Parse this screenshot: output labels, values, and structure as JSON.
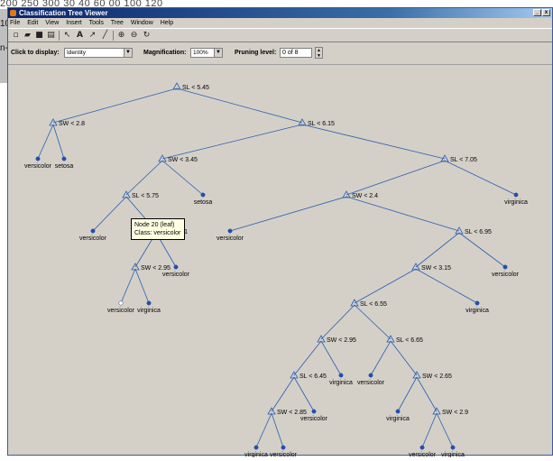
{
  "background": {
    "ruler_text": "200    250    300  30    40    60    00    100   120",
    "left_labels": [
      "10",
      "n-"
    ]
  },
  "window": {
    "title": "Classification Tree Viewer",
    "buttons": {
      "minimize": "_",
      "maximize": "□",
      "close": "x"
    }
  },
  "menu": [
    "File",
    "Edit",
    "View",
    "Insert",
    "Tools",
    "Tree",
    "Window",
    "Help"
  ],
  "toolbar": {
    "icons": [
      "new-file-icon",
      "open-folder-icon",
      "save-icon",
      "print-icon",
      "pointer-icon",
      "text-icon",
      "arrow-icon",
      "line-icon",
      "zoom-in-icon",
      "zoom-out-icon",
      "rotate-icon"
    ],
    "glyphs": [
      "▫",
      "▰",
      "■",
      "▤",
      "↖",
      "A",
      "↗",
      "╱",
      "⊕",
      "⊖",
      "↻"
    ]
  },
  "controls": {
    "click_label": "Click to display:",
    "click_value": "Identity",
    "magnification_label": "Magnification:",
    "magnification_value": "100%",
    "pruning_label": "Pruning level:",
    "pruning_value": "0 of 8"
  },
  "tree": {
    "nodes": [
      {
        "id": 1,
        "label": "SL < 5.45",
        "type": "branch"
      },
      {
        "id": 2,
        "label": "SW < 2.8",
        "type": "branch"
      },
      {
        "id": 3,
        "label": "SL < 6.15",
        "type": "branch"
      },
      {
        "id": 4,
        "label": "versicolor",
        "type": "leaf"
      },
      {
        "id": 5,
        "label": "setosa",
        "type": "leaf"
      },
      {
        "id": 6,
        "label": "SW < 3.45",
        "type": "branch"
      },
      {
        "id": 7,
        "label": "SL < 7.05",
        "type": "branch"
      },
      {
        "id": 8,
        "label": "SL < 5.75",
        "type": "branch"
      },
      {
        "id": 9,
        "label": "setosa",
        "type": "leaf"
      },
      {
        "id": 10,
        "label": "SW < 2.4",
        "type": "branch"
      },
      {
        "id": 11,
        "label": "virginica",
        "type": "leaf"
      },
      {
        "id": 12,
        "label": "versicolor",
        "type": "leaf"
      },
      {
        "id": 13,
        "label": "SW < 3.1",
        "type": "branch"
      },
      {
        "id": 14,
        "label": "versicolor",
        "type": "leaf"
      },
      {
        "id": 15,
        "label": "SL < 6.95",
        "type": "branch"
      },
      {
        "id": 16,
        "label": "SW < 2.95",
        "type": "branch"
      },
      {
        "id": 17,
        "label": "versicolor",
        "type": "leaf"
      },
      {
        "id": 18,
        "label": "SW < 3.15",
        "type": "branch"
      },
      {
        "id": 19,
        "label": "versicolor",
        "type": "leaf"
      },
      {
        "id": 20,
        "label": "versicolor",
        "type": "leaf"
      },
      {
        "id": 21,
        "label": "virginica",
        "type": "leaf"
      },
      {
        "id": 22,
        "label": "SL < 6.55",
        "type": "branch"
      },
      {
        "id": 23,
        "label": "virginica",
        "type": "leaf"
      },
      {
        "id": 24,
        "label": "SW < 2.95",
        "type": "branch"
      },
      {
        "id": 25,
        "label": "SL < 6.65",
        "type": "branch"
      },
      {
        "id": 26,
        "label": "SL < 6.45",
        "type": "branch"
      },
      {
        "id": 27,
        "label": "virginica",
        "type": "leaf"
      },
      {
        "id": 28,
        "label": "versicolor",
        "type": "leaf"
      },
      {
        "id": 29,
        "label": "SW < 2.65",
        "type": "branch"
      },
      {
        "id": 30,
        "label": "SW < 2.85",
        "type": "branch"
      },
      {
        "id": 31,
        "label": "versicolor",
        "type": "leaf"
      },
      {
        "id": 32,
        "label": "virginica",
        "type": "leaf"
      },
      {
        "id": 33,
        "label": "SW < 2.9",
        "type": "branch"
      },
      {
        "id": 34,
        "label": "virginica",
        "type": "leaf"
      },
      {
        "id": 35,
        "label": "versicolor",
        "type": "leaf"
      },
      {
        "id": 36,
        "label": "versicolor",
        "type": "leaf"
      },
      {
        "id": 37,
        "label": "virginica",
        "type": "leaf"
      }
    ]
  },
  "tooltip": {
    "line1": "Node 20 (leaf)",
    "line2": "Class: versicolor"
  },
  "colors": {
    "branch_line": "#2a5db0",
    "leaf_dot": "#1f4fb0",
    "selected_leaf": "#ffffff",
    "canvas_bg": "#d4d0c8"
  }
}
